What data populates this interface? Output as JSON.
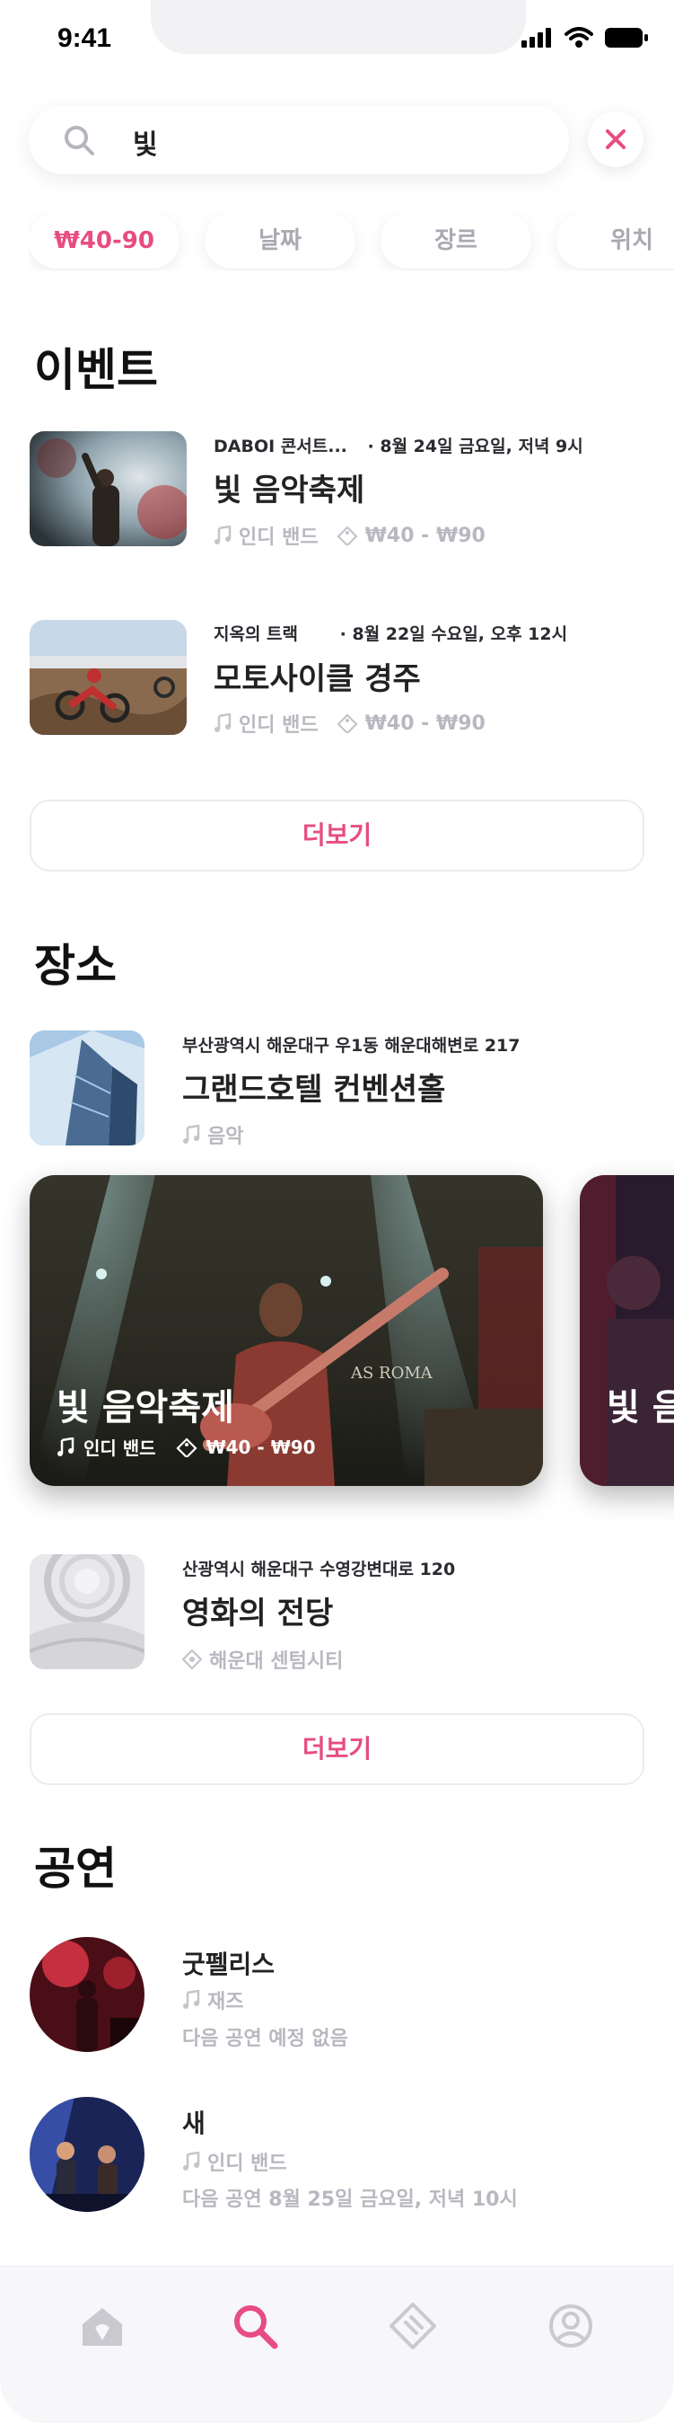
{
  "status_bar": {
    "time": "9:41"
  },
  "search": {
    "query": "빛"
  },
  "filters": [
    {
      "label": "₩40-90",
      "active": true
    },
    {
      "label": "날짜",
      "active": false
    },
    {
      "label": "장르",
      "active": false
    },
    {
      "label": "위치",
      "active": false
    }
  ],
  "events": {
    "title": "이벤트",
    "items": [
      {
        "venue": "DABOI 콘서트...",
        "datetime": "· 8월 24일 금요일, 저녁 9시",
        "name": "빛 음악축제",
        "genre": "인디 밴드",
        "price": "₩40 - ₩90"
      },
      {
        "venue": "지옥의 트랙",
        "datetime": "· 8월 22일 수요일, 오후 12시",
        "name": "모토사이클 경주",
        "genre": "인디 밴드",
        "price": "₩40 - ₩90"
      }
    ],
    "more_label": "더보기"
  },
  "places": {
    "title": "장소",
    "items": [
      {
        "address": "부산광역시 해운대구 우1동 해운대해변로 217",
        "name": "그랜드호텔 컨벤션홀",
        "category": "음악"
      },
      {
        "address": "산광역시 해운대구 수영강변대로 120",
        "name": "영화의 전당",
        "category": "해운대 센텀시티"
      }
    ],
    "featured": [
      {
        "name": "빛 음악축제",
        "genre": "인디 밴드",
        "price": "₩40 - ₩90",
        "sign": "AS ROMA"
      },
      {
        "name": "빛 음"
      }
    ],
    "more_label": "더보기"
  },
  "performers": {
    "title": "공연",
    "items": [
      {
        "name": "굿펠리스",
        "genre": "재즈",
        "next": "다음 공연 예정 없음"
      },
      {
        "name": "새",
        "genre": "인디 밴드",
        "next": "다음 공연 8월 25일 금요일, 저녁 10시"
      }
    ]
  },
  "tabbar": {
    "items": [
      {
        "icon": "home-icon",
        "active": false
      },
      {
        "icon": "search-icon",
        "active": true
      },
      {
        "icon": "ticket-icon",
        "active": false
      },
      {
        "icon": "profile-icon",
        "active": false
      }
    ]
  },
  "colors": {
    "accent": "#e74c82",
    "muted": "#b8b8c0",
    "text": "#222222"
  }
}
